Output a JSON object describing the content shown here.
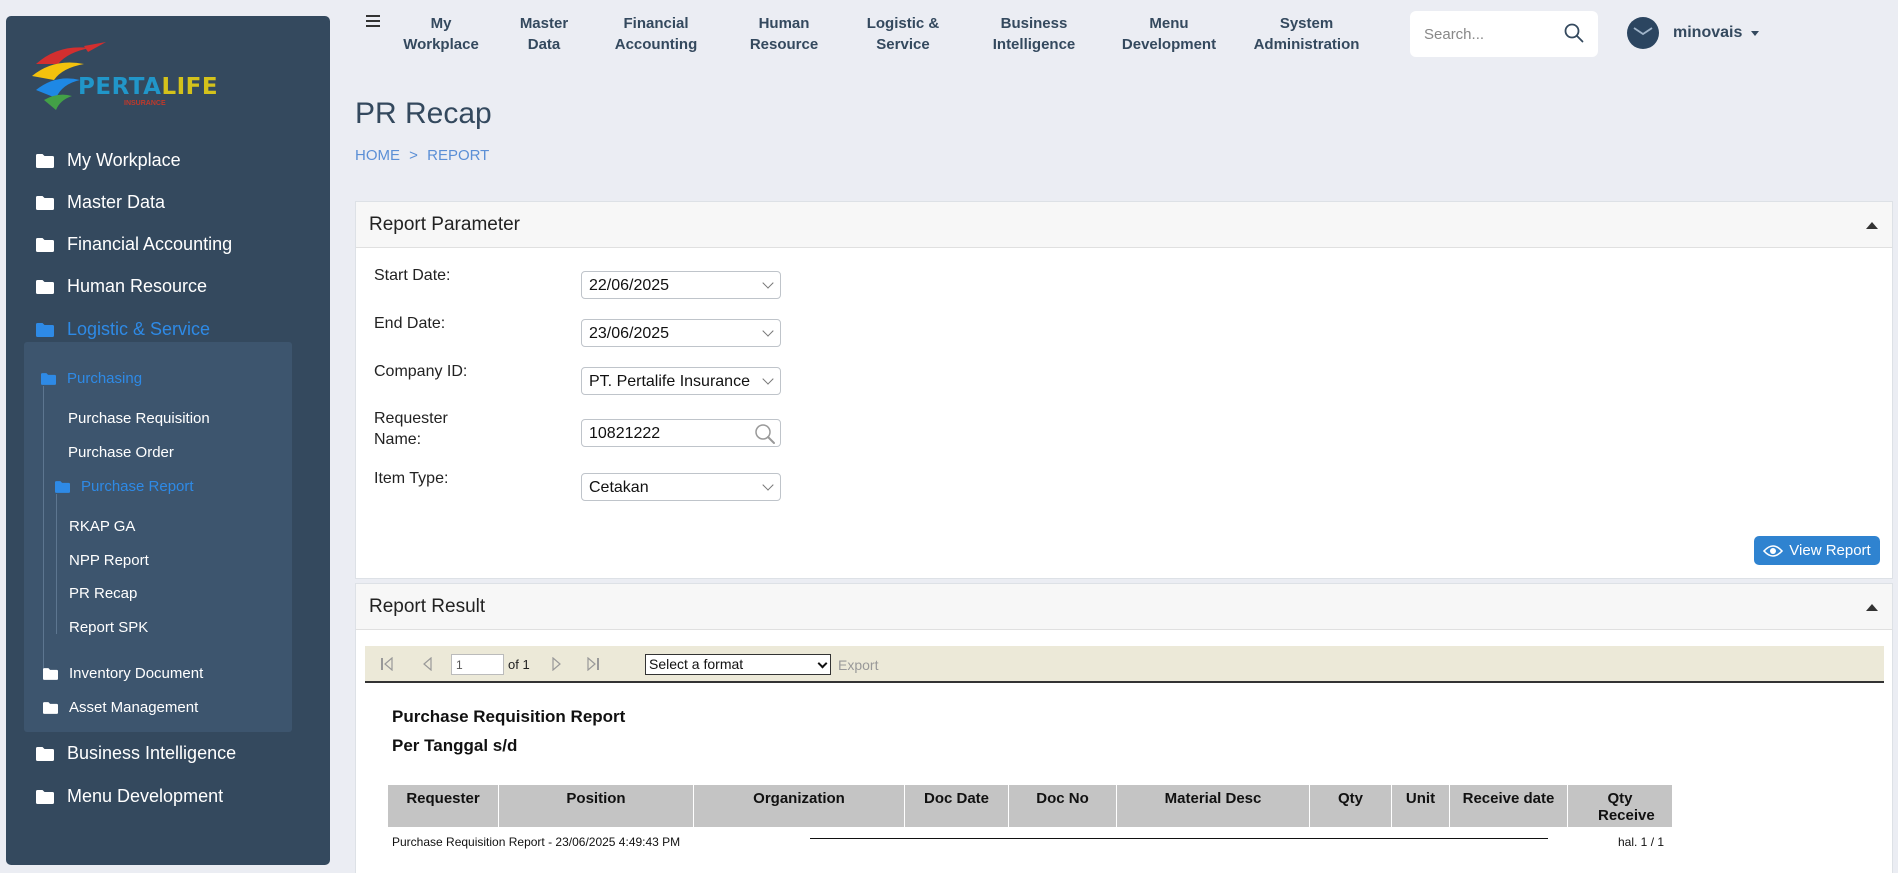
{
  "sidebar": {
    "logo": {
      "brand_blue": "PERTA",
      "brand_yellow": "LIFE",
      "tagline": "INSURANCE"
    },
    "items": [
      {
        "label": "My Workplace"
      },
      {
        "label": "Master Data"
      },
      {
        "label": "Financial Accounting"
      },
      {
        "label": "Human Resource"
      },
      {
        "label": "Logistic & Service"
      },
      {
        "label": "Business Intelligence"
      },
      {
        "label": "Menu Development"
      }
    ],
    "sub": {
      "purchasing": "Purchasing",
      "purchase_requisition": "Purchase Requisition",
      "purchase_order": "Purchase Order",
      "purchase_report": "Purchase Report",
      "rkap_ga": "RKAP GA",
      "npp_report": "NPP Report",
      "pr_recap": "PR Recap",
      "report_spk": "Report SPK",
      "inventory_document": "Inventory Document",
      "asset_management": "Asset Management"
    }
  },
  "topnav": {
    "items": [
      {
        "line1": "My",
        "line2": "Workplace"
      },
      {
        "line1": "Master",
        "line2": "Data"
      },
      {
        "line1": "Financial",
        "line2": "Accounting"
      },
      {
        "line1": "Human",
        "line2": "Resource"
      },
      {
        "line1": "Logistic &",
        "line2": "Service"
      },
      {
        "line1": "Business",
        "line2": "Intelligence"
      },
      {
        "line1": "Menu",
        "line2": "Development"
      },
      {
        "line1": "System",
        "line2": "Administration"
      }
    ],
    "search_placeholder": "Search...",
    "user_name": "minovais"
  },
  "page": {
    "title": "PR Recap",
    "breadcrumb_home": "HOME",
    "breadcrumb_sep": ">",
    "breadcrumb_current": "REPORT"
  },
  "params": {
    "panel_title": "Report Parameter",
    "start_date_label": "Start Date:",
    "start_date_value": "22/06/2025",
    "end_date_label": "End Date:",
    "end_date_value": "23/06/2025",
    "company_label": "Company ID:",
    "company_value": "PT. Pertalife Insurance",
    "requester_label_1": "Requester",
    "requester_label_2": "Name:",
    "requester_value": "10821222",
    "item_type_label": "Item Type:",
    "item_type_value": "Cetakan",
    "view_button": "View Report"
  },
  "result": {
    "panel_title": "Report Result",
    "page_current": "1",
    "page_of": "of 1",
    "format_placeholder": "Select a format",
    "export_label": "Export",
    "report_title": "Purchase Requisition Report",
    "report_subtitle": "Per Tanggal  s/d",
    "columns": [
      "Requester",
      "Position",
      "Organization",
      "Doc Date",
      "Doc No",
      "Material Desc",
      "Qty",
      "Unit",
      "Receive date",
      "Qty Receive"
    ],
    "footer_text": "Purchase Requisition Report - 23/06/2025 4:49:43 PM",
    "footer_page": "hal. 1 / 1"
  },
  "colors": {
    "sidebar_bg": "#34495e",
    "accent": "#2e8ae6",
    "button_bg": "#2f83d0",
    "page_bg": "#ebedf3"
  }
}
